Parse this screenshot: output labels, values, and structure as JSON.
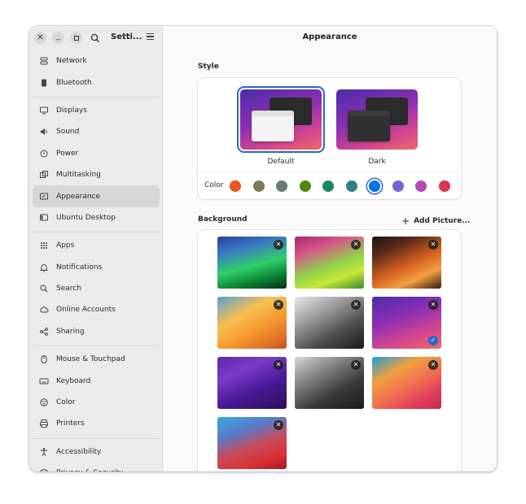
{
  "window": {
    "sidebar_title": "Setti...",
    "main_title": "Appearance"
  },
  "sidebar": {
    "groups": [
      [
        {
          "label": "Network",
          "icon": "network-icon"
        },
        {
          "label": "Bluetooth",
          "icon": "bluetooth-icon"
        }
      ],
      [
        {
          "label": "Displays",
          "icon": "display-icon"
        },
        {
          "label": "Sound",
          "icon": "speaker-icon"
        },
        {
          "label": "Power",
          "icon": "power-icon"
        },
        {
          "label": "Multitasking",
          "icon": "multitasking-icon"
        },
        {
          "label": "Appearance",
          "icon": "appearance-icon",
          "active": true
        },
        {
          "label": "Ubuntu Desktop",
          "icon": "ubuntu-desktop-icon"
        }
      ],
      [
        {
          "label": "Apps",
          "icon": "apps-grid-icon"
        },
        {
          "label": "Notifications",
          "icon": "bell-icon"
        },
        {
          "label": "Search",
          "icon": "search-icon"
        },
        {
          "label": "Online Accounts",
          "icon": "cloud-icon"
        },
        {
          "label": "Sharing",
          "icon": "share-icon"
        }
      ],
      [
        {
          "label": "Mouse & Touchpad",
          "icon": "mouse-icon"
        },
        {
          "label": "Keyboard",
          "icon": "keyboard-icon"
        },
        {
          "label": "Color",
          "icon": "color-icon"
        },
        {
          "label": "Printers",
          "icon": "printer-icon"
        }
      ],
      [
        {
          "label": "Accessibility",
          "icon": "accessibility-icon"
        },
        {
          "label": "Privacy & Security",
          "icon": "privacy-icon"
        }
      ]
    ]
  },
  "style": {
    "section_label": "Style",
    "options": [
      {
        "label": "Default",
        "selected": true
      },
      {
        "label": "Dark",
        "selected": false
      }
    ],
    "color_label": "Color",
    "colors": [
      "#e95420",
      "#7d7a5a",
      "#687b74",
      "#4e8a0e",
      "#1a8a5e",
      "#308280",
      "#0073e5",
      "#7764d8",
      "#b34cb3",
      "#da3450"
    ],
    "selected_color": "#0073e5"
  },
  "background": {
    "section_label": "Background",
    "add_label": "Add Picture...",
    "selected_index": 5
  }
}
